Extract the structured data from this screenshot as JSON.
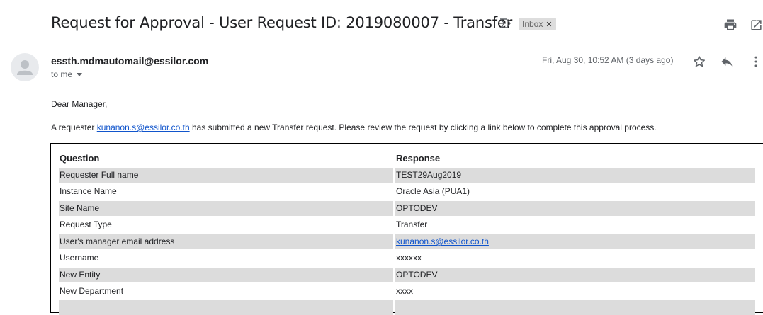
{
  "email": {
    "subject": "Request for Approval - User Request ID: 2019080007 - Transfer",
    "label_chip": "Inbox",
    "sender": "essth.mdmautomail@essilor.com",
    "recipient": "to me",
    "date": "Fri, Aug 30, 10:52 AM (3 days ago)"
  },
  "body": {
    "greeting": "Dear Manager,",
    "intro_before": "A requester ",
    "intro_link": "kunanon.s@essilor.co.th",
    "intro_after": " has submitted a new Transfer request. Please review the request by clicking a link below to complete this approval process."
  },
  "table": {
    "headers": [
      "Question",
      "Response"
    ],
    "rows": [
      {
        "q": "Requester Full name",
        "r": "TEST29Aug2019"
      },
      {
        "q": "Instance Name",
        "r": "Oracle Asia (PUA1)"
      },
      {
        "q": "Site Name",
        "r": "OPTODEV"
      },
      {
        "q": "Request Type",
        "r": "Transfer"
      },
      {
        "q": "User's manager email address",
        "r": "kunanon.s@essilor.co.th"
      },
      {
        "q": "Username",
        "r": "xxxxxx"
      },
      {
        "q": "New Entity",
        "r": "OPTODEV"
      },
      {
        "q": "New Department",
        "r": "xxxx"
      }
    ]
  },
  "icons": {
    "label": "label-arrow-icon",
    "print": "print-icon",
    "open_new": "open-in-new-window-icon",
    "avatar": "person-avatar-icon",
    "star": "star-icon",
    "reply": "reply-icon",
    "more": "more-vertical-icon"
  }
}
